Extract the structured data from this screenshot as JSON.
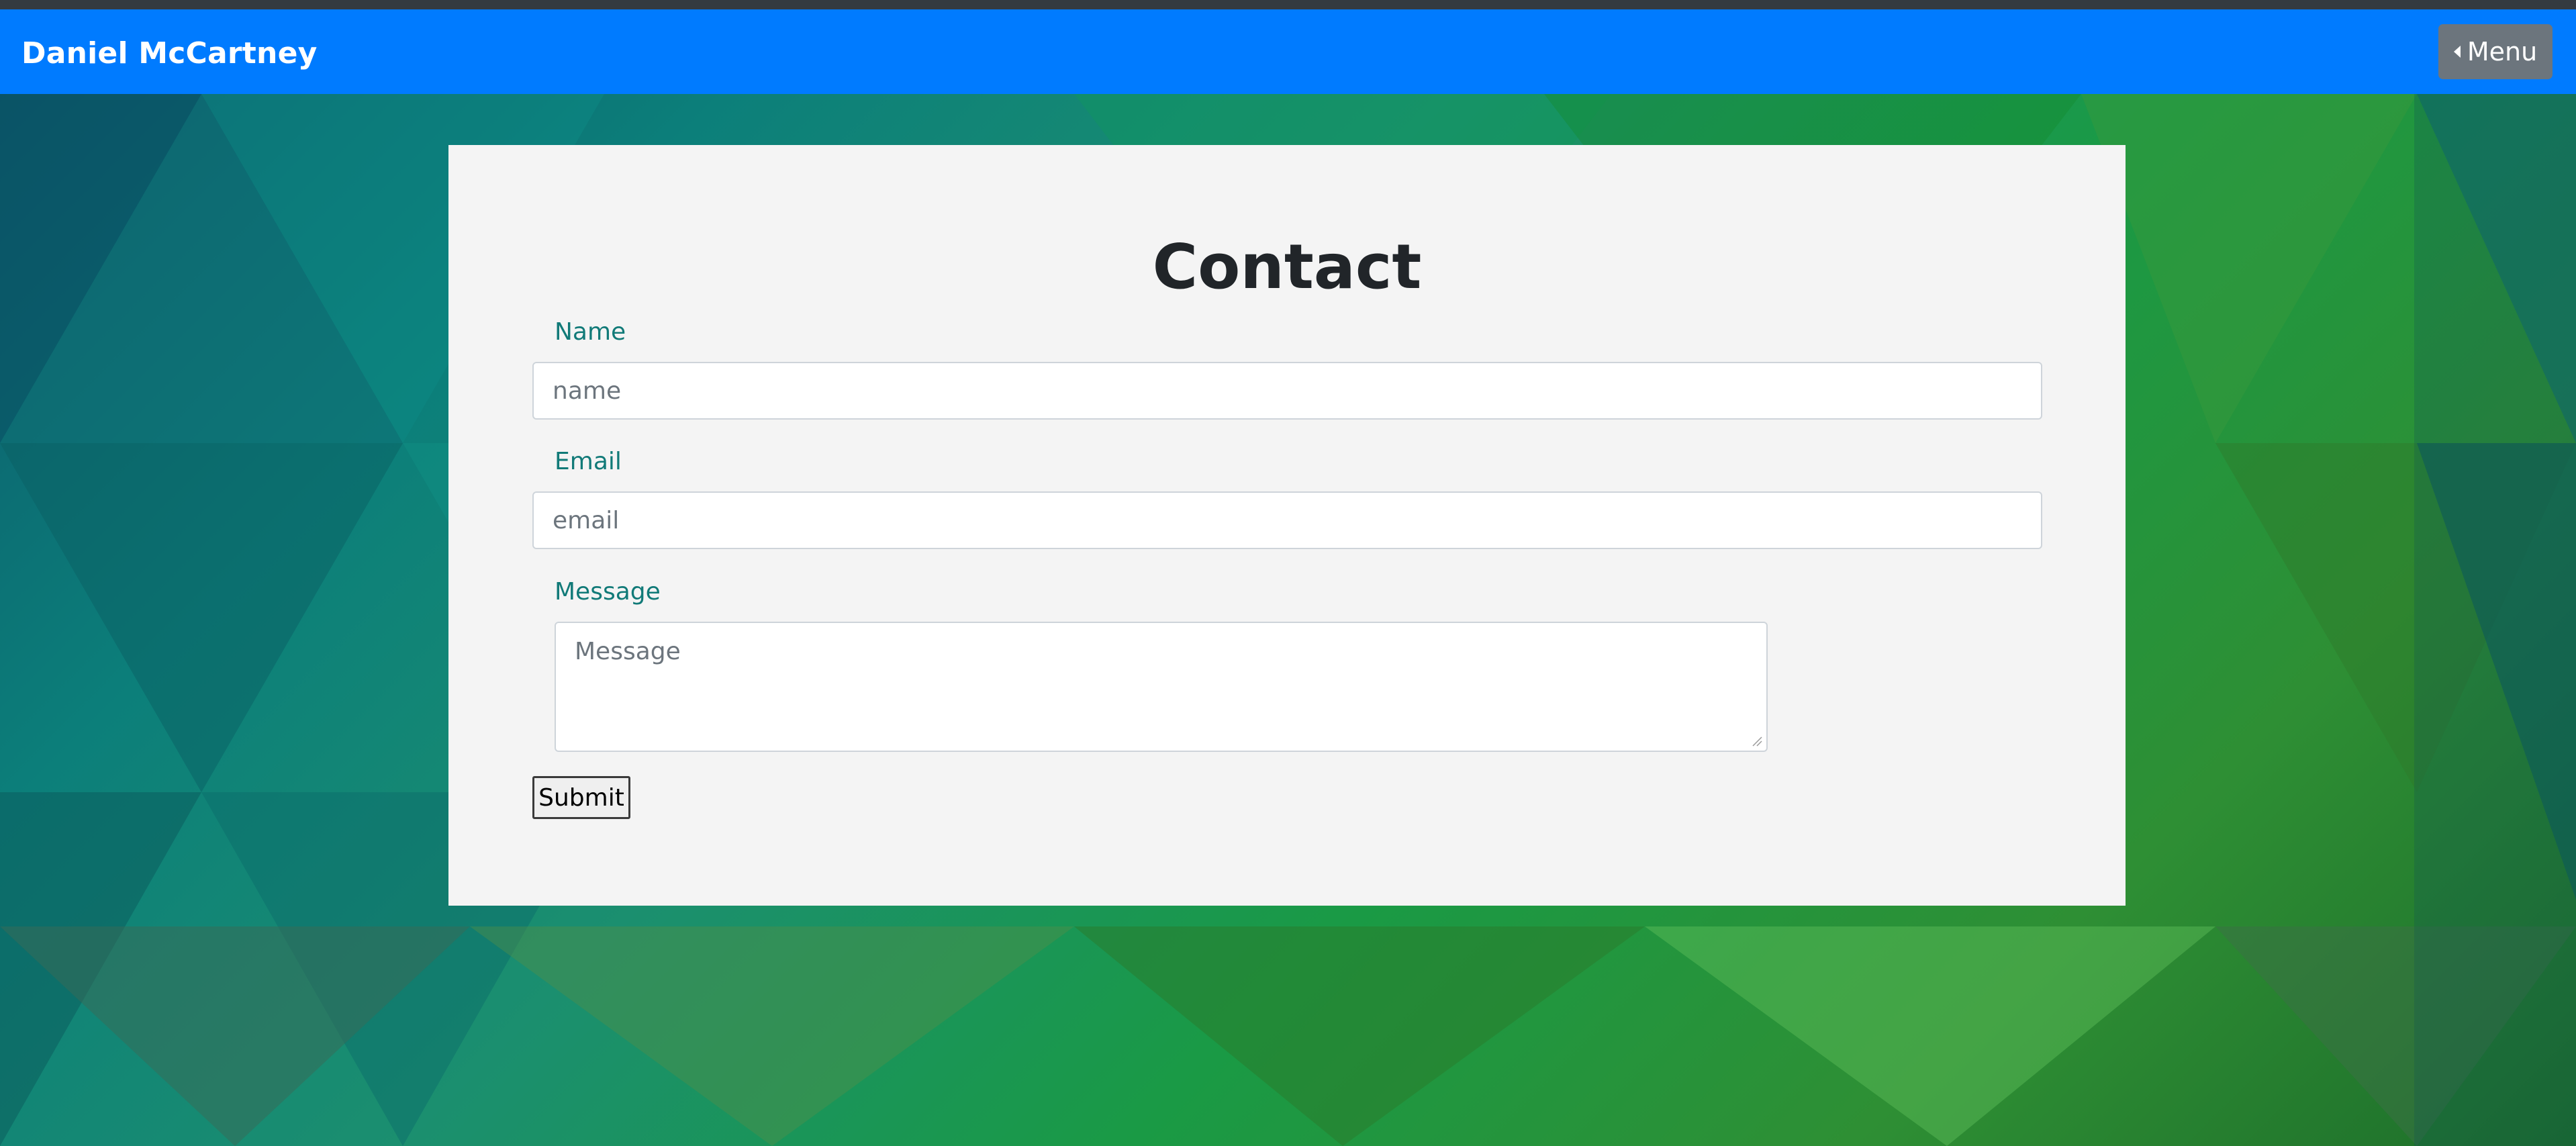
{
  "header": {
    "brand": "Daniel McCartney",
    "menu_label": "Menu",
    "menu_icon": "caret-left-icon"
  },
  "contact": {
    "title": "Contact",
    "name_label": "Name",
    "name_placeholder": "name",
    "email_label": "Email",
    "email_placeholder": "email",
    "message_label": "Message",
    "message_placeholder": "Message",
    "submit_label": "Submit"
  },
  "colors": {
    "navbar": "#007bff",
    "menu_button": "#6c757d",
    "label_text": "#117a78",
    "card_background": "#f4f4f4"
  }
}
